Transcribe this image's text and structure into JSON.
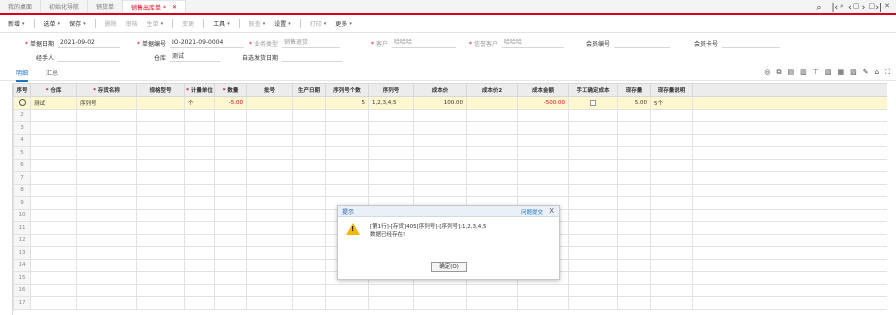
{
  "tabs": [
    {
      "label": "我的桌面",
      "active": false
    },
    {
      "label": "初始化导航",
      "active": false
    },
    {
      "label": "销货单",
      "active": false
    },
    {
      "label": "销售出库单 *",
      "active": true
    }
  ],
  "toolbar": [
    {
      "label": "新增",
      "caret": true,
      "disabled": false
    },
    {
      "label": "选单",
      "caret": true,
      "disabled": false
    },
    {
      "label": "保存",
      "caret": true,
      "disabled": false
    },
    {
      "label": "删除",
      "caret": false,
      "disabled": true
    },
    {
      "label": "审核",
      "caret": false,
      "disabled": true
    },
    {
      "label": "生单",
      "caret": true,
      "disabled": true
    },
    {
      "label": "变更",
      "caret": false,
      "disabled": true
    },
    {
      "label": "工具",
      "caret": true,
      "disabled": false
    },
    {
      "label": "联查",
      "caret": true,
      "disabled": true
    },
    {
      "label": "设置",
      "caret": true,
      "disabled": false
    },
    {
      "label": "打印",
      "caret": true,
      "disabled": true
    },
    {
      "label": "更多",
      "caret": true,
      "disabled": false
    }
  ],
  "form": {
    "doc_date_label": "单据日期",
    "doc_date": "2021-09-02",
    "doc_no_label": "单据编号",
    "doc_no": "IO-2021-09-0004",
    "biz_type_label": "业务类型",
    "biz_type": "销售退货",
    "customer_label": "客户",
    "customer": "哈哈哈",
    "settle_customer_label": "信誉客户",
    "settle_customer": "哈哈哈",
    "member_no_label": "会员编号",
    "member_no": "",
    "member_card_label": "会员卡号",
    "member_card": "",
    "handler_label": "经手人",
    "handler": "",
    "warehouse_label": "仓库",
    "warehouse": "测试",
    "ship_date_label": "自选发货日期",
    "ship_date": ""
  },
  "subtabs": [
    "明细",
    "汇总"
  ],
  "grid": {
    "headers": [
      {
        "label": "序号",
        "req": false
      },
      {
        "label": "仓库",
        "req": true
      },
      {
        "label": "存货名称",
        "req": true
      },
      {
        "label": "规格型号",
        "req": false
      },
      {
        "label": "计量单位",
        "req": true
      },
      {
        "label": "数量",
        "req": true
      },
      {
        "label": "批号",
        "req": false
      },
      {
        "label": "生产日期",
        "req": false
      },
      {
        "label": "序列号个数",
        "req": false
      },
      {
        "label": "序列号",
        "req": false
      },
      {
        "label": "成本价",
        "req": false
      },
      {
        "label": "成本价2",
        "req": false
      },
      {
        "label": "成本金额",
        "req": false
      },
      {
        "label": "手工确定成本",
        "req": false
      },
      {
        "label": "现存量",
        "req": false
      },
      {
        "label": "现存量说明",
        "req": false
      },
      {
        "label": "",
        "req": false
      }
    ],
    "first_row": {
      "warehouse": "测试",
      "item": "序列号",
      "spec": "",
      "unit": "个",
      "qty": "-5.00",
      "batch": "",
      "prod_date": "",
      "serial_count": "5",
      "serial": "1,2,3,4,5",
      "cost": "100.00",
      "cost2": "",
      "cost_amount": "-500.00",
      "stock": "5.00",
      "stock_desc": "5个"
    },
    "row_numbers": [
      "2",
      "3",
      "4",
      "5",
      "6",
      "7",
      "8",
      "9",
      "10",
      "11",
      "12",
      "13",
      "14",
      "15",
      "16",
      "17"
    ]
  },
  "dialog": {
    "title": "提示",
    "copy_label": "问题提交",
    "close": "X",
    "line1": "[第1行]-[存货]405[序列号]-[序列号]:1,2,3,4,5",
    "line2": "数据已经存在!",
    "ok_label": "确定(O)"
  }
}
